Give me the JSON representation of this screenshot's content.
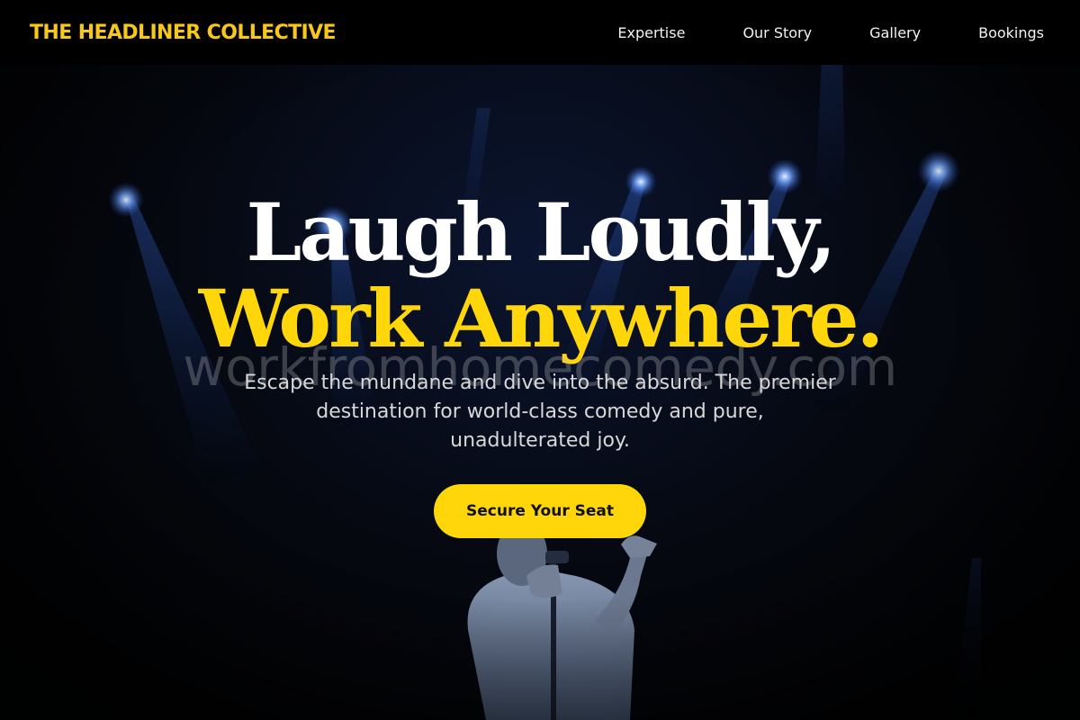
{
  "nav": {
    "brand": "THE HEADLINER COLLECTIVE",
    "links": [
      {
        "label": "Expertise"
      },
      {
        "label": "Our Story"
      },
      {
        "label": "Gallery"
      },
      {
        "label": "Bookings"
      }
    ]
  },
  "hero": {
    "headline_line1": "Laugh Loudly,",
    "headline_line2": "Work Anywhere.",
    "watermark": "workfromhomecomedy.com",
    "tagline": "Escape the mundane and dive into the absurd. The premier destination for world-class comedy and pure, unadulterated joy.",
    "cta_label": "Secure Your Seat",
    "background_image": "comedian performing on stage with microphone under blue spotlights"
  },
  "colors": {
    "accent": "#ffd60a",
    "nav_background": "#000000",
    "headline_white": "#ffffff",
    "tagline_text": "#d8d8d8"
  }
}
